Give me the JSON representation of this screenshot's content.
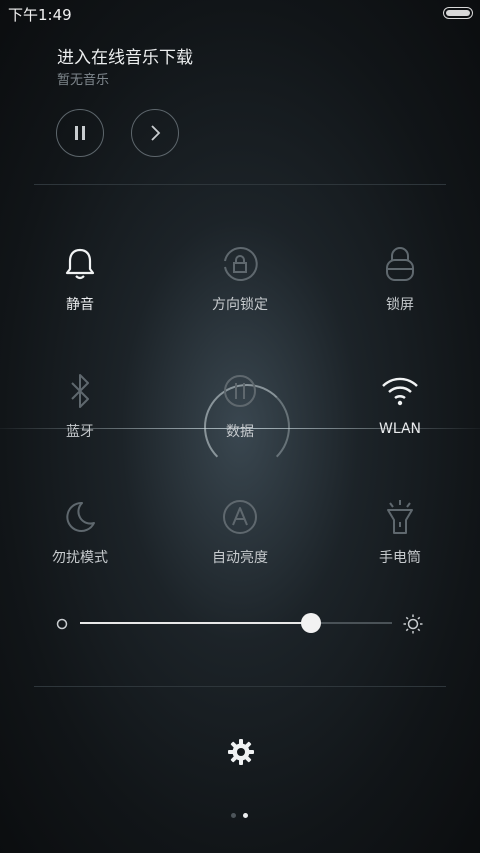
{
  "status_bar": {
    "time": "下午1:49"
  },
  "music": {
    "title": "进入在线音乐下载",
    "subtitle": "暂无音乐",
    "pause_icon": "pause-icon",
    "next_icon": "chevron-right-icon"
  },
  "toggles": [
    {
      "id": "mute",
      "label": "静音",
      "icon": "bell-icon",
      "active": true
    },
    {
      "id": "rotation-lock",
      "label": "方向锁定",
      "icon": "rotation-lock-icon",
      "active": false
    },
    {
      "id": "lock-screen",
      "label": "锁屏",
      "icon": "lock-icon",
      "active": false
    },
    {
      "id": "bluetooth",
      "label": "蓝牙",
      "icon": "bluetooth-icon",
      "active": false
    },
    {
      "id": "data",
      "label": "数据",
      "icon": "mobile-data-icon",
      "active": false
    },
    {
      "id": "wlan",
      "label": "WLAN",
      "icon": "wifi-icon",
      "active": true
    },
    {
      "id": "do-not-disturb",
      "label": "勿扰模式",
      "icon": "moon-icon",
      "active": false
    },
    {
      "id": "auto-brightness",
      "label": "自动亮度",
      "icon": "auto-brightness-icon",
      "active": false
    },
    {
      "id": "flashlight",
      "label": "手电筒",
      "icon": "flashlight-icon",
      "active": false
    }
  ],
  "brightness": {
    "level": 0.74,
    "low_icon": "brightness-low-icon",
    "high_icon": "brightness-high-icon"
  },
  "settings": {
    "icon": "gear-icon"
  },
  "pagination": {
    "pages": 2,
    "current": 2
  },
  "colors": {
    "active": "#f0f2f3",
    "inactive": "#5f686e",
    "background": "#14191c"
  }
}
